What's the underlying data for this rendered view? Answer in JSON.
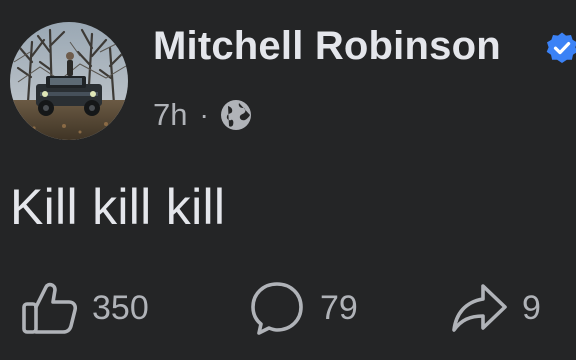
{
  "post": {
    "author": {
      "name": "Mitchell Robinson",
      "verified_icon": "verified-badge-icon",
      "verified_color": "#3b82f6",
      "avatar_icon": "profile-photo"
    },
    "meta": {
      "time": "7h",
      "separator": "·",
      "audience_icon": "globe-icon"
    },
    "text": "Kill kill kill",
    "actions": {
      "like": {
        "count": "350",
        "icon": "thumbs-up-icon"
      },
      "comment": {
        "count": "79",
        "icon": "comment-bubble-icon"
      },
      "share": {
        "count": "9",
        "icon": "share-arrow-icon"
      }
    }
  },
  "colors": {
    "background": "#242526",
    "primary_text": "#e4e6eb",
    "secondary_text": "#b0b3b8"
  }
}
